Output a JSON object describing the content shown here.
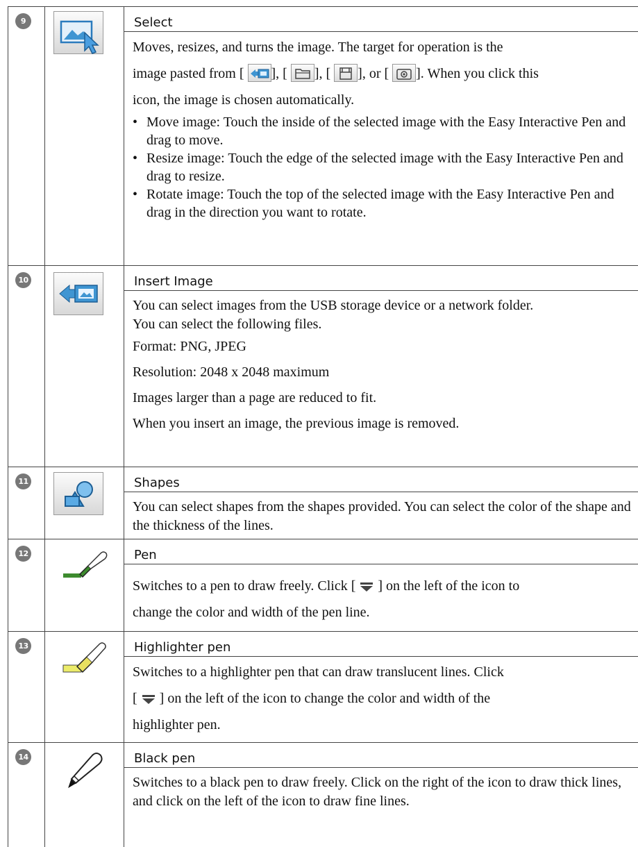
{
  "rows": [
    {
      "number": "9",
      "icon": "select-image-icon",
      "title": "Select",
      "paragraphs": [
        "Moves, resizes, and turns the image. The target for operation is the",
        "image pasted from [",
        "], [",
        "], [",
        "], or [",
        "]. When you click this",
        "icon, the image is chosen automatically."
      ],
      "inline_icons": [
        "insert-image-icon",
        "folder-icon",
        "scanner-icon",
        "camera-icon"
      ],
      "bullets": [
        "Move image: Touch the inside of the selected image with the Easy Interactive Pen and drag to move.",
        "Resize image: Touch the edge of the selected image with the Easy Interactive Pen and drag to resize.",
        "Rotate image: Touch the top of the selected image with the Easy Interactive Pen and drag in the direction you want to rotate."
      ]
    },
    {
      "number": "10",
      "icon": "insert-image-icon",
      "title": "Insert Image",
      "lines": [
        "You can select images from the USB storage device or a network folder.",
        "You can select the following files.",
        "Format: PNG, JPEG",
        "Resolution: 2048 x 2048 maximum",
        "Images larger than a page are reduced to fit.",
        "When you insert an image, the previous image is removed."
      ]
    },
    {
      "number": "11",
      "icon": "shapes-icon",
      "title": "Shapes",
      "text": "You can select shapes from the shapes provided. You can select the color of the shape and the thickness of the lines."
    },
    {
      "number": "12",
      "icon": "green-pen-icon",
      "title": "Pen",
      "text_before": "Switches to a pen to draw freely. Click [",
      "text_after": "] on the left of the icon to",
      "text_line2": "change the color and width of the pen line."
    },
    {
      "number": "13",
      "icon": "highlighter-pen-icon",
      "title": "Highlighter pen",
      "text_line1": "Switches to a highlighter pen that can draw translucent lines. Click",
      "text_before": "[",
      "text_after": "] on the left of the icon to change the color and width of the",
      "text_line3": "highlighter pen."
    },
    {
      "number": "14",
      "icon": "black-pen-icon",
      "title": "Black pen",
      "text": "Switches to a black pen to draw freely. Click on the right of the icon to draw thick lines, and click on the left of the icon to draw fine lines."
    }
  ]
}
